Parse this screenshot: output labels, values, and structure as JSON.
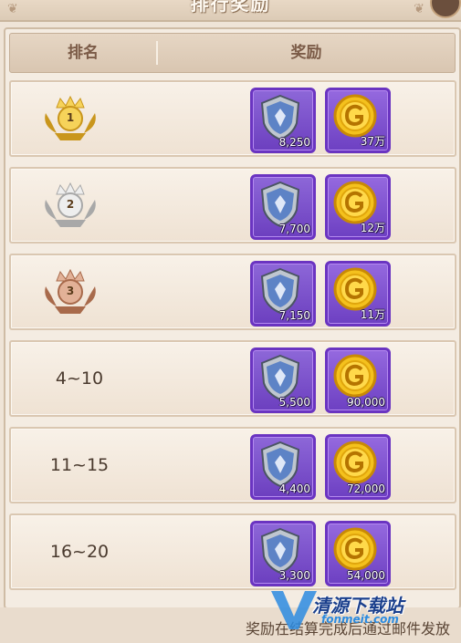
{
  "title": "排行奖励",
  "header": {
    "rank_label": "排名",
    "reward_label": "奖励"
  },
  "rows": [
    {
      "rank": "",
      "medal": "gold-1",
      "medal_number": "1",
      "rewards": [
        {
          "icon": "shield-icon",
          "qty": "8,250"
        },
        {
          "icon": "gold-coin-icon",
          "qty": "37万"
        }
      ]
    },
    {
      "rank": "",
      "medal": "silver-2",
      "medal_number": "2",
      "rewards": [
        {
          "icon": "shield-icon",
          "qty": "7,700"
        },
        {
          "icon": "gold-coin-icon",
          "qty": "12万"
        }
      ]
    },
    {
      "rank": "",
      "medal": "bronze-3",
      "medal_number": "3",
      "rewards": [
        {
          "icon": "shield-icon",
          "qty": "7,150"
        },
        {
          "icon": "gold-coin-icon",
          "qty": "11万"
        }
      ]
    },
    {
      "rank": "4~10",
      "rewards": [
        {
          "icon": "shield-icon",
          "qty": "5,500"
        },
        {
          "icon": "gold-coin-icon",
          "qty": "90,000"
        }
      ]
    },
    {
      "rank": "11~15",
      "rewards": [
        {
          "icon": "shield-icon",
          "qty": "4,400"
        },
        {
          "icon": "gold-coin-icon",
          "qty": "72,000"
        }
      ]
    },
    {
      "rank": "16~20",
      "rewards": [
        {
          "icon": "shield-icon",
          "qty": "3,300"
        },
        {
          "icon": "gold-coin-icon",
          "qty": "54,000"
        }
      ]
    }
  ],
  "footer": {
    "note": "奖励在结算完成后通过邮件发放"
  },
  "watermark": {
    "name": "清源下载站",
    "url": "fonmeit.com"
  },
  "colors": {
    "item_border": "#6a34c1",
    "gold": "#f2c21b",
    "silver": "#c9c9c9",
    "bronze": "#c98f6e"
  }
}
